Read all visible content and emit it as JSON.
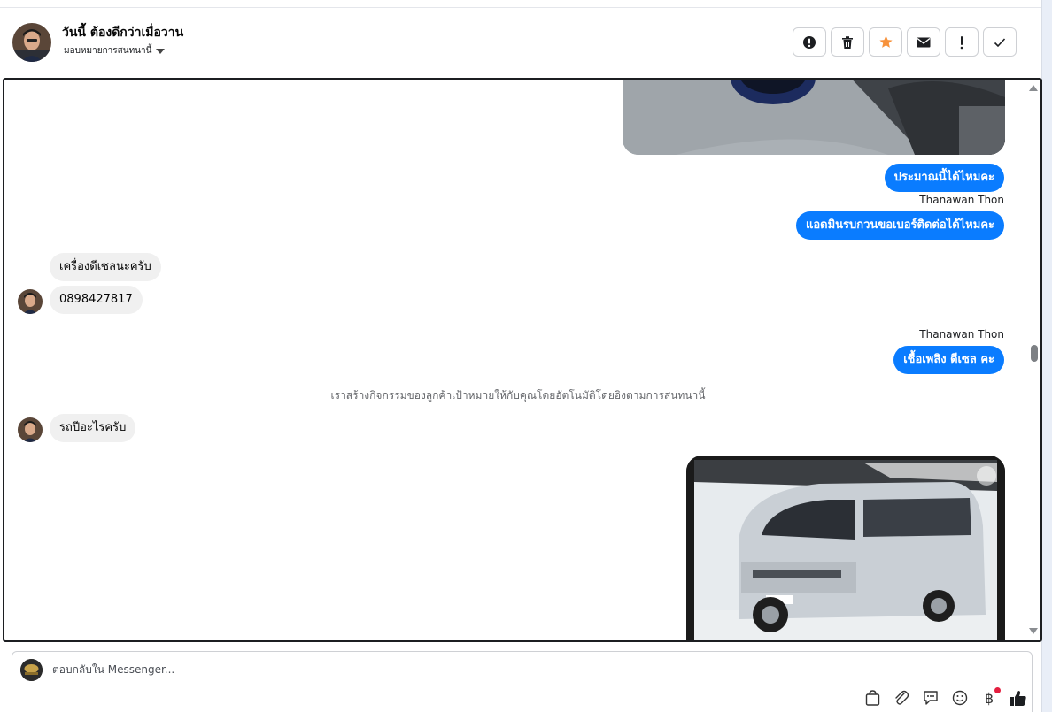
{
  "header": {
    "contact_name": "วันนี้ ต้องดีกว่าเมื่อวาน",
    "assign_label": "มอบหมายการสนทนานี้",
    "actions": [
      "report-icon",
      "trash-icon",
      "star-icon",
      "mail-icon",
      "exclamation-icon",
      "check-icon"
    ]
  },
  "thread": {
    "messages": [
      {
        "dir": "out",
        "type": "image",
        "alt": "Blower gauge photo"
      },
      {
        "dir": "out",
        "text": "ประมาณนี้ได้ไหมคะ"
      },
      {
        "sender": "Thanawan Thon"
      },
      {
        "dir": "out",
        "text": "แอดมินรบกวนขอเบอร์ติดต่อได้ไหมคะ"
      },
      {
        "dir": "in",
        "text": "เครื่องดีเซลนะครับ"
      },
      {
        "dir": "in",
        "text": "0898427817"
      },
      {
        "sender": "Thanawan Thon"
      },
      {
        "dir": "out",
        "text": "เชื้อเพลิง ดีเซล คะ"
      },
      {
        "system": "เราสร้างกิจกรรมของลูกค้าเป้าหมายให้กับคุณโดยอัตโนมัติโดยอิงตามการสนทนานี้"
      },
      {
        "dir": "in",
        "text": "รถปีอะไรครับ"
      },
      {
        "dir": "out",
        "type": "image",
        "alt": "Silver van photo"
      }
    ],
    "out_1": "ประมาณนี้ได้ไหมคะ",
    "sender_1": "Thanawan Thon",
    "out_2": "แอดมินรบกวนขอเบอร์ติดต่อได้ไหมคะ",
    "in_1": "เครื่องดีเซลนะครับ",
    "in_2": "0898427817",
    "sender_2": "Thanawan Thon",
    "out_3": "เชื้อเพลิง ดีเซล คะ",
    "system_note": "เราสร้างกิจกรรมของลูกค้าเป้าหมายให้กับคุณโดยอัตโนมัติโดยอิงตามการสนทนานี้",
    "in_3": "รถปีอะไรครับ"
  },
  "composer": {
    "placeholder": "ตอบกลับใน Messenger...",
    "tools": [
      "bag-icon",
      "paperclip-icon",
      "saved-reply-icon",
      "emoji-icon",
      "baht-icon",
      "thumbs-up-icon"
    ],
    "baht_symbol": "฿"
  },
  "colors": {
    "outgoing_bubble": "#0a7cff",
    "incoming_bubble": "#f0f0f0",
    "star": "#f7923b",
    "notification_dot": "#e41e3f"
  }
}
